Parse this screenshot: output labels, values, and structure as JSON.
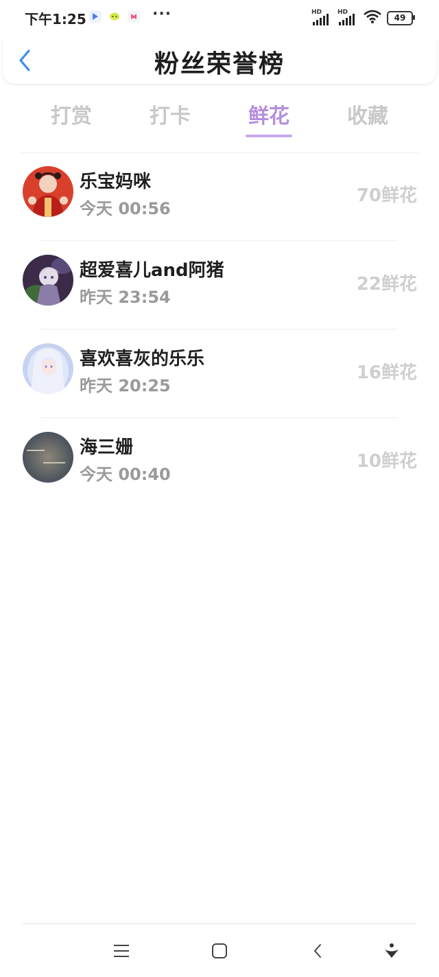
{
  "status_bar": {
    "time": "下午1:25",
    "more": "···",
    "network_1": "HD",
    "network_2": "HD",
    "battery": "49"
  },
  "header": {
    "title": "粉丝荣誉榜"
  },
  "tabs": [
    {
      "label": "打赏",
      "active": false
    },
    {
      "label": "打卡",
      "active": false
    },
    {
      "label": "鲜花",
      "active": true
    },
    {
      "label": "收藏",
      "active": false
    }
  ],
  "ranking": [
    {
      "name": "乐宝妈咪",
      "time": "今天 00:56",
      "amount": "70鲜花"
    },
    {
      "name": "超爱喜儿and阿猪",
      "time": "昨天 23:54",
      "amount": "22鲜花"
    },
    {
      "name": "喜欢喜灰的乐乐",
      "time": "昨天 20:25",
      "amount": "16鲜花"
    },
    {
      "name": "海三姗",
      "time": "今天 00:40",
      "amount": "10鲜花"
    }
  ],
  "colors": {
    "accent": "#b48ee0",
    "back_arrow": "#3a8fe8"
  }
}
